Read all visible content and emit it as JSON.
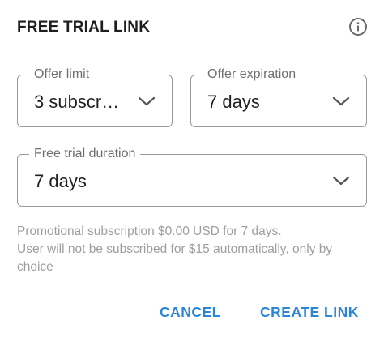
{
  "dialog": {
    "title": "FREE TRIAL LINK",
    "info_icon": "info-circle-icon"
  },
  "fields": {
    "offer_limit": {
      "label": "Offer limit",
      "value": "3 subscr…"
    },
    "offer_expiration": {
      "label": "Offer expiration",
      "value": "7 days"
    },
    "free_trial_duration": {
      "label": "Free trial duration",
      "value": "7 days"
    }
  },
  "description": {
    "line1": "Promotional subscription $0.00 USD for 7 days.",
    "line2": "User will not be subscribed for $15 automatically, only by choice"
  },
  "actions": {
    "cancel_label": "CANCEL",
    "create_label": "CREATE LINK"
  },
  "colors": {
    "accent": "#2a86d6",
    "text_primary": "#212121",
    "text_secondary": "#9e9e9e",
    "border": "#9a9a9a"
  }
}
